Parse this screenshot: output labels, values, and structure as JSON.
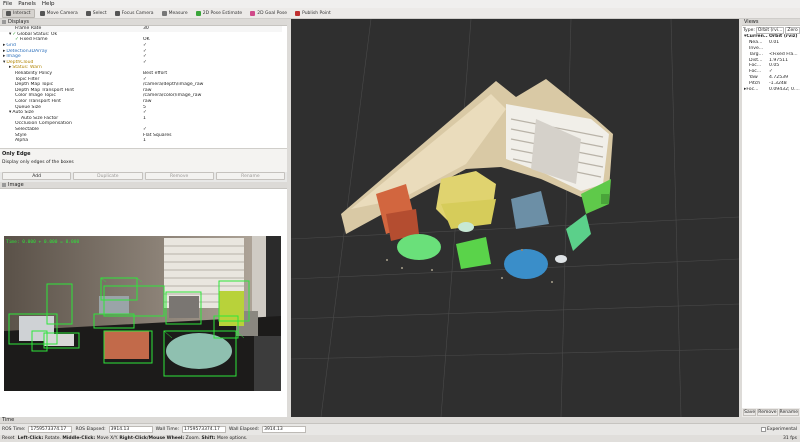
{
  "menu": [
    "File",
    "Panels",
    "Help"
  ],
  "toolbar": [
    {
      "label": "Interact",
      "icon": "cursor-icon",
      "active": true
    },
    {
      "label": "Move Camera",
      "icon": "move-icon"
    },
    {
      "label": "Select",
      "icon": "select-icon"
    },
    {
      "label": "Focus Camera",
      "icon": "focus-icon"
    },
    {
      "label": "Measure",
      "icon": "ruler-icon"
    },
    {
      "label": "2D Pose Estimate",
      "icon": "arrow-green-icon"
    },
    {
      "label": "2D Goal Pose",
      "icon": "arrow-pink-icon"
    },
    {
      "label": "Publish Point",
      "icon": "pin-icon"
    }
  ],
  "displays": {
    "title": "Displays",
    "rows": [
      {
        "k": "Frame Rate",
        "v": "30",
        "indent": 2
      },
      {
        "k": "Global Status: Ok",
        "v": "",
        "indent": 1,
        "exp": "▾",
        "check": "✓"
      },
      {
        "k": "Fixed Frame",
        "v": "OK",
        "indent": 2,
        "check": "✓"
      },
      {
        "k": "Grid",
        "v": "✓",
        "indent": 0,
        "exp": "▸",
        "cls": "hl"
      },
      {
        "k": "Detection3DArray",
        "v": "✓",
        "indent": 0,
        "exp": "▸",
        "cls": "hl"
      },
      {
        "k": "Image",
        "v": "✓",
        "indent": 0,
        "exp": "▸",
        "cls": "hl"
      },
      {
        "k": "DepthCloud",
        "v": "✓",
        "indent": 0,
        "exp": "▾",
        "cls": "hl2"
      },
      {
        "k": "Status: Warn",
        "v": "",
        "indent": 1,
        "exp": "▸",
        "cls": "hl2"
      },
      {
        "k": "Reliability Policy",
        "v": "Best effort",
        "indent": 2
      },
      {
        "k": "Topic Filter",
        "v": "✓",
        "indent": 2
      },
      {
        "k": "Depth Map Topic",
        "v": "/camera/depth/image_raw",
        "indent": 2
      },
      {
        "k": "Depth Map Transport Hint",
        "v": "raw",
        "indent": 2
      },
      {
        "k": "Color Image Topic",
        "v": "/camera/color/image_raw",
        "indent": 2
      },
      {
        "k": "Color Transport Hint",
        "v": "raw",
        "indent": 2
      },
      {
        "k": "Queue Size",
        "v": "5",
        "indent": 2
      },
      {
        "k": "Auto Size",
        "v": "✓",
        "indent": 1,
        "exp": "▾"
      },
      {
        "k": "Auto Size Factor",
        "v": "1",
        "indent": 3
      },
      {
        "k": "Occlusion Compensation",
        "v": "",
        "indent": 2
      },
      {
        "k": "Selectable",
        "v": "✓",
        "indent": 2
      },
      {
        "k": "Style",
        "v": "Flat Squares",
        "indent": 2
      },
      {
        "k": "Alpha",
        "v": "1",
        "indent": 2
      }
    ],
    "desc_title": "Only Edge",
    "desc_text": "Display only edges of the boxes",
    "buttons": [
      "Add",
      "Duplicate",
      "Remove",
      "Rename"
    ]
  },
  "image_panel": {
    "title": "Image",
    "overlay_text": "Time: 0.000 + 0.000 = 0.000"
  },
  "views": {
    "title": "Views",
    "type_label": "Type:",
    "type_value": "Orbit (rvi...",
    "zero": "Zero",
    "rows": [
      {
        "k": "Curren...",
        "v": "Orbit (rviz)",
        "bold": true,
        "exp": "▾"
      },
      {
        "k": "Nea...",
        "v": "0.01"
      },
      {
        "k": "Inve...",
        "v": ""
      },
      {
        "k": "Targ...",
        "v": "<Fixed Fra..."
      },
      {
        "k": "Dist...",
        "v": "1.97511"
      },
      {
        "k": "Foc...",
        "v": "0.05"
      },
      {
        "k": "Foc...",
        "v": "✓"
      },
      {
        "k": "Yaw",
        "v": "4.72539"
      },
      {
        "k": "Pitch",
        "v": "-1.3248"
      },
      {
        "k": "Foc...",
        "v": "0.09432; 0....",
        "exp": "▸"
      }
    ],
    "buttons": [
      "Save",
      "Remove",
      "Rename"
    ]
  },
  "time": {
    "title": "Time",
    "ros_time_label": "ROS Time:",
    "ros_time": "1759573374.17",
    "ros_elapsed_label": "ROS Elapsed:",
    "ros_elapsed": "3914.13",
    "wall_time_label": "Wall Time:",
    "wall_time": "1759573374.17",
    "wall_elapsed_label": "Wall Elapsed:",
    "wall_elapsed": "3914.13",
    "experimental": "Experimental"
  },
  "status": {
    "reset": "Reset",
    "left_click": "Left-Click:",
    "left_click_action": "Rotate.",
    "middle_click": "Middle-Click:",
    "middle_click_action": "Move X/Y.",
    "right_click": "Right-Click/Mouse Wheel:",
    "right_click_action": "Zoom.",
    "shift": "Shift:",
    "shift_action": "More options.",
    "fps": "31 fps"
  }
}
